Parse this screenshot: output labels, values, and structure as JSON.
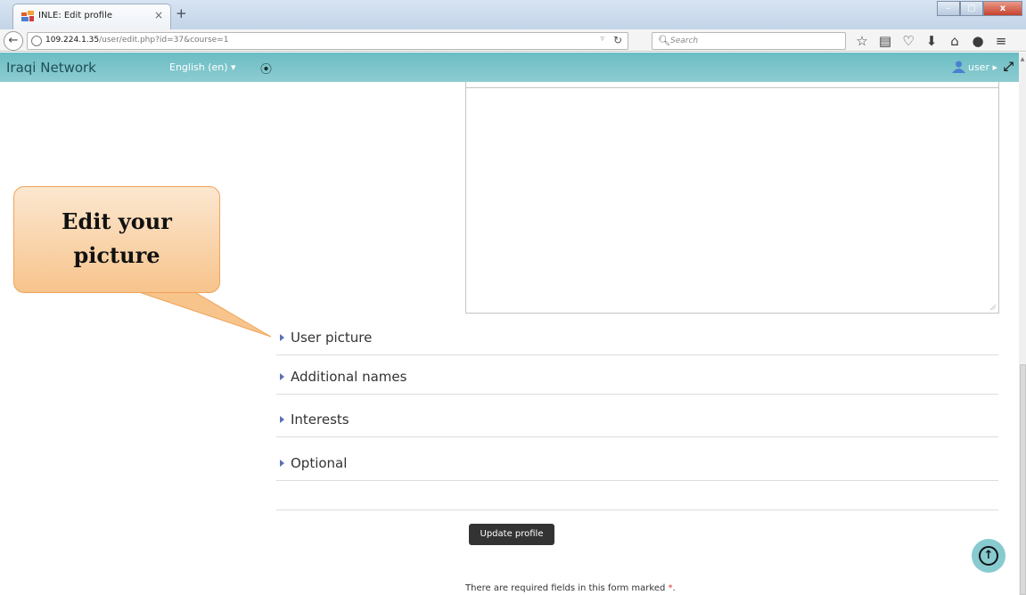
{
  "browser": {
    "tab_title": "INLE: Edit profile",
    "tab_close": "×",
    "new_tab": "+",
    "url_host": "109.224.1.35",
    "url_path": "/user/edit.php?id=37&course=1",
    "search_placeholder": "Search",
    "window_controls": [
      "–",
      "▢",
      "x"
    ],
    "toolbar_icons": [
      "star-icon",
      "reading-list-icon",
      "pocket-icon",
      "download-icon",
      "home-icon",
      "chat-icon",
      "menu-icon"
    ]
  },
  "header": {
    "site_name": "Iraqi Network",
    "language": "English (en) ▾",
    "user_label": "user ▸"
  },
  "sections": [
    {
      "label": "User picture"
    },
    {
      "label": "Additional names"
    },
    {
      "label": "Interests"
    },
    {
      "label": "Optional"
    }
  ],
  "form": {
    "submit_label": "Update profile",
    "required_note": "There are required fields in this form marked ",
    "required_star": "*",
    "required_end": "."
  },
  "callout": {
    "line1": "Edit your",
    "line2": "picture"
  },
  "colors": {
    "header_bg": "#7cc5cb",
    "section_arrow": "#5a6fb6",
    "callout_fill": "#f7c48c",
    "callout_border": "#f0a35a"
  }
}
